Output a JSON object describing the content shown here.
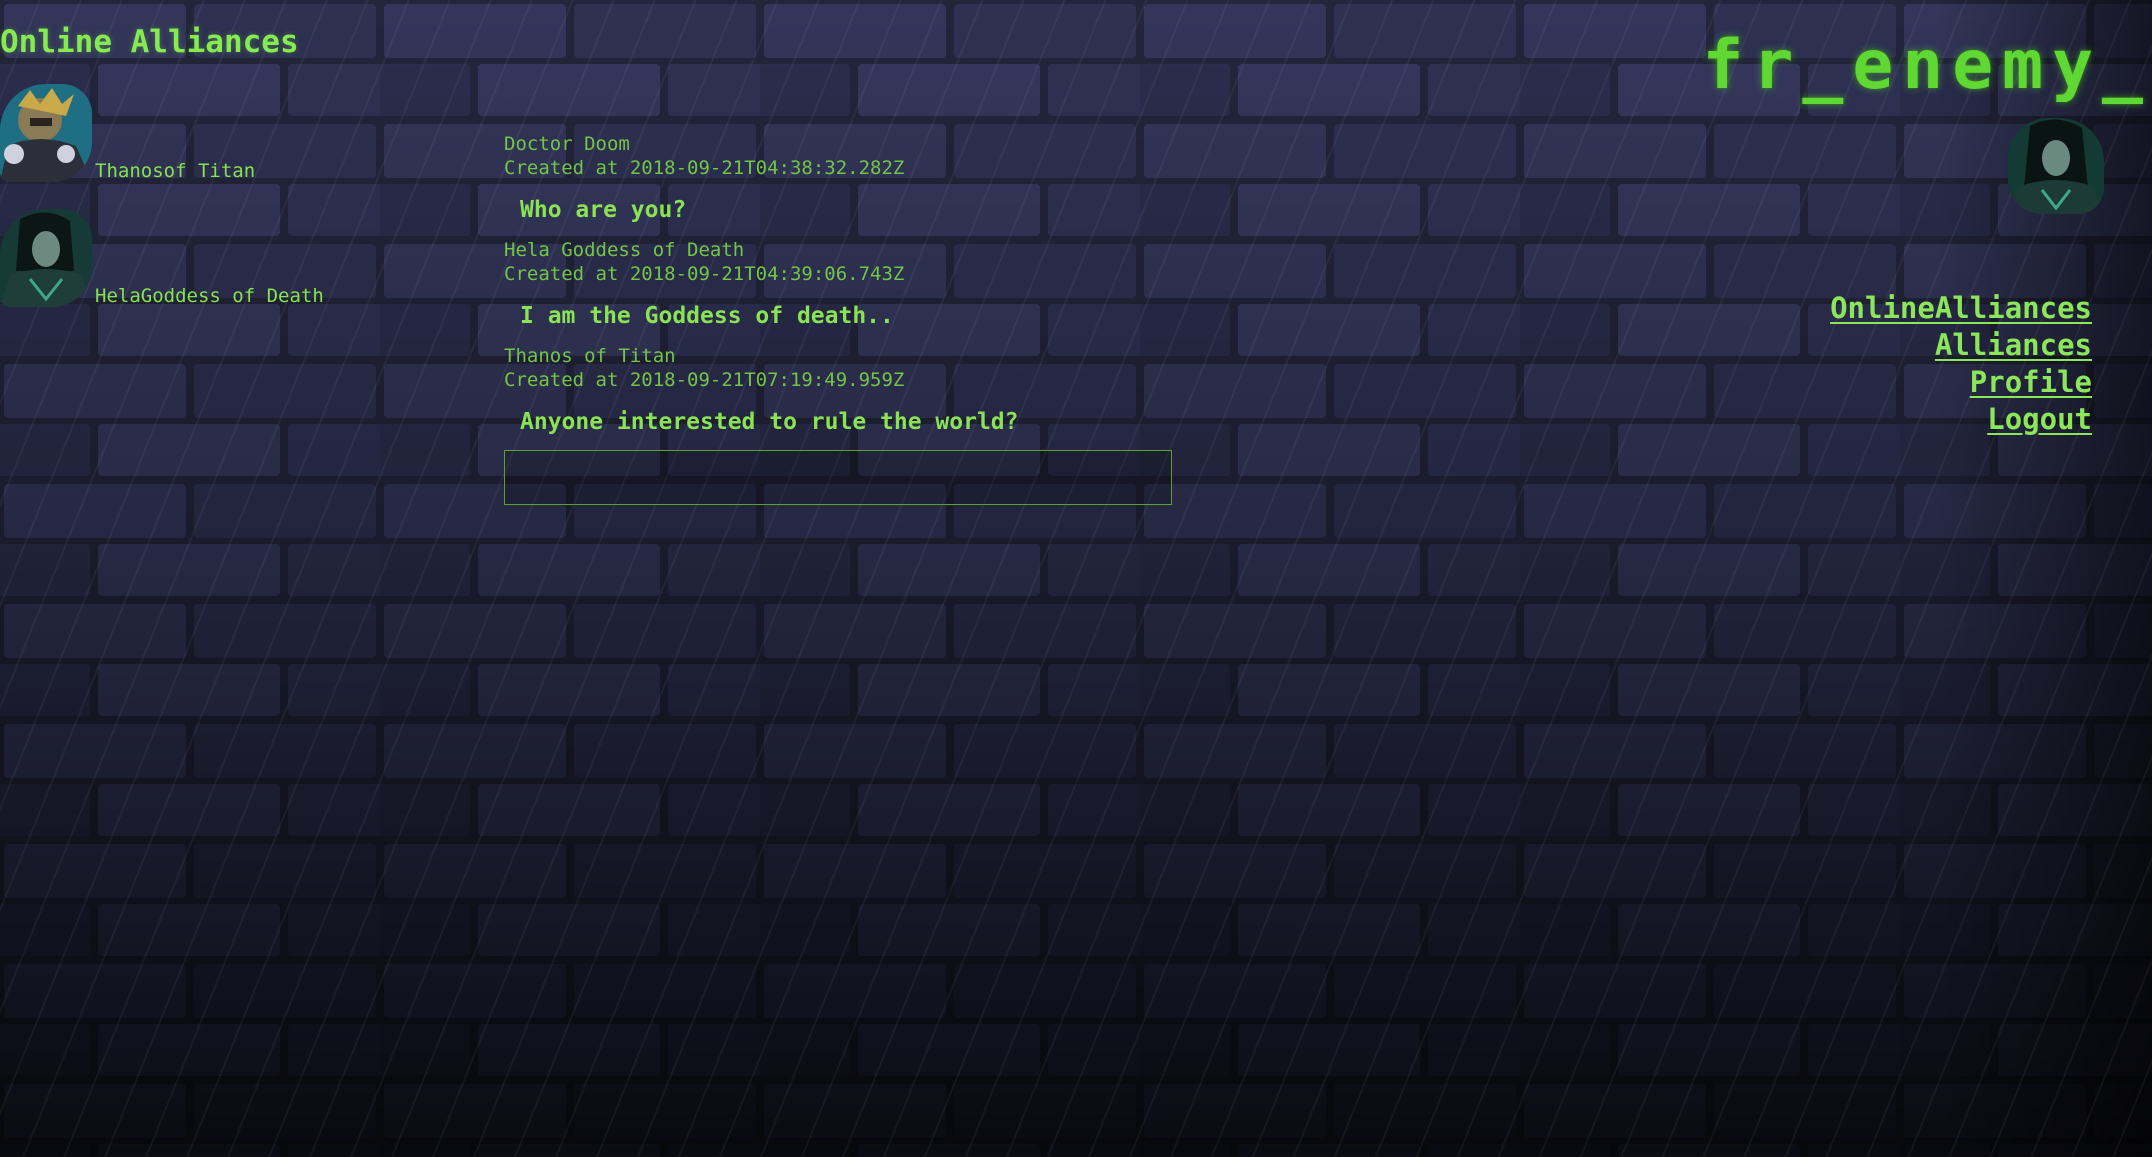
{
  "sidebar": {
    "title": "Online Alliances",
    "users": [
      {
        "name": "Thanosof Titan",
        "avatar": "thanos-avatar"
      },
      {
        "name": "HelaGoddess of Death",
        "avatar": "hela-avatar"
      }
    ]
  },
  "chat": {
    "messages": [
      {
        "author": "Doctor Doom",
        "created": "Created at 2018-09-21T04:38:32.282Z",
        "text": "Who are you?"
      },
      {
        "author": "Hela Goddess of Death",
        "created": "Created at 2018-09-21T04:39:06.743Z",
        "text": "I am the Goddess of death.."
      },
      {
        "author": "Thanos of Titan",
        "created": "Created at 2018-09-21T07:19:49.959Z",
        "text": "Anyone interested to rule the world?"
      }
    ],
    "input_value": ""
  },
  "header": {
    "brand": "fr_enemy_"
  },
  "nav": {
    "items": [
      "OnlineAlliances",
      "Alliances",
      "Profile",
      "Logout"
    ]
  },
  "colors": {
    "accent": "#7ee24a",
    "background": "#282a44"
  }
}
